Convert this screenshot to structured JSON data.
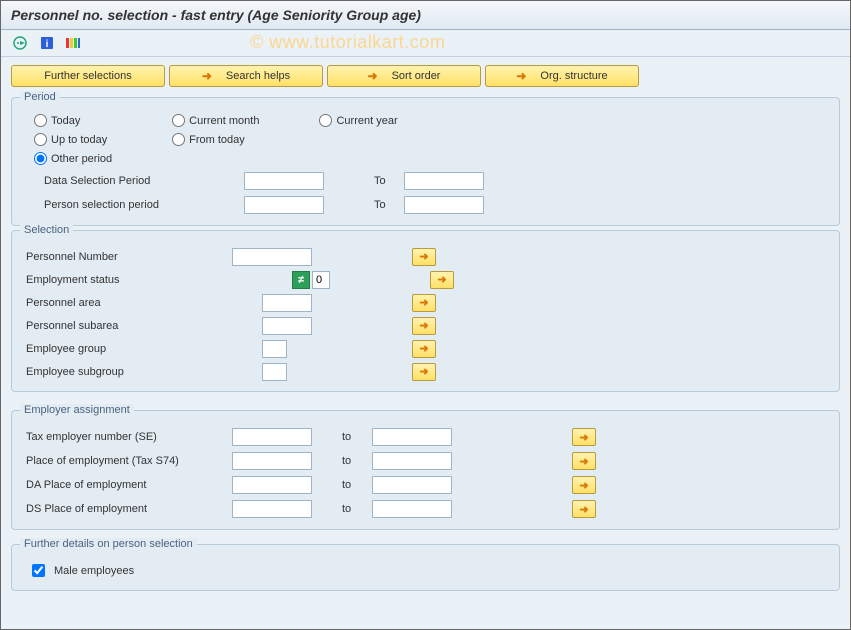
{
  "title": "Personnel no. selection - fast entry (Age Seniority Group age)",
  "watermark": "© www.tutorialkart.com",
  "buttons": {
    "further": "Further selections",
    "search": "Search helps",
    "sort": "Sort order",
    "org": "Org. structure"
  },
  "period": {
    "title": "Period",
    "today": "Today",
    "upto": "Up to today",
    "other": "Other period",
    "curmonth": "Current month",
    "fromtoday": "From today",
    "curyear": "Current year",
    "dataSel": "Data Selection Period",
    "personSel": "Person selection period",
    "to": "To"
  },
  "selection": {
    "title": "Selection",
    "pernr": "Personnel Number",
    "empstatus": "Employment status",
    "empstatus_val": "0",
    "persarea": "Personnel area",
    "perssubarea": "Personnel subarea",
    "empgroup": "Employee group",
    "empsubgroup": "Employee subgroup"
  },
  "employer": {
    "title": "Employer assignment",
    "taxemp": "Tax employer number (SE)",
    "placeemp": "Place of employment (Tax S74)",
    "daplace": "DA Place of employment",
    "dsplace": "DS Place of employment",
    "to": "to"
  },
  "further": {
    "title": "Further details on person selection",
    "male": "Male employees"
  }
}
